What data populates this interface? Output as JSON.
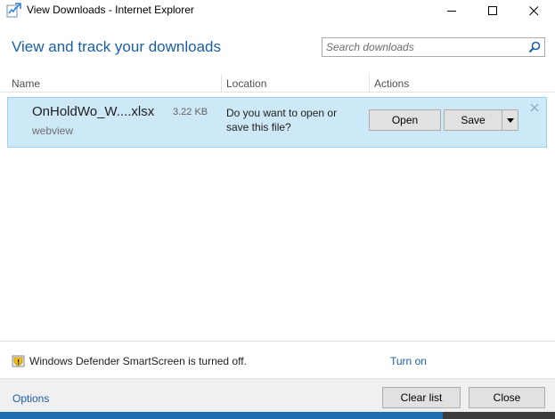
{
  "window": {
    "title": "View Downloads - Internet Explorer"
  },
  "header": {
    "title": "View and track your downloads",
    "search_placeholder": "Search downloads"
  },
  "columns": {
    "name": "Name",
    "location": "Location",
    "actions": "Actions"
  },
  "download": {
    "file_name": "OnHoldWo_W....xlsx",
    "file_size": "3.22 KB",
    "source": "webview",
    "prompt": "Do you want to open or save this file?",
    "open_label": "Open",
    "save_label": "Save"
  },
  "smartscreen": {
    "status_text": "Windows Defender SmartScreen is turned off.",
    "turn_on_label": "Turn on"
  },
  "footer": {
    "options_label": "Options",
    "clear_list_label": "Clear list",
    "close_label": "Close"
  },
  "colors": {
    "accent": "#1a5fa8",
    "row_selected": "#cde8f6",
    "row_border": "#9fd0ee"
  },
  "icons": [
    "ie-downloads-icon",
    "minimize-icon",
    "maximize-icon",
    "close-icon",
    "search-icon",
    "dismiss-icon",
    "chevron-down-icon",
    "smartscreen-warning-icon"
  ]
}
